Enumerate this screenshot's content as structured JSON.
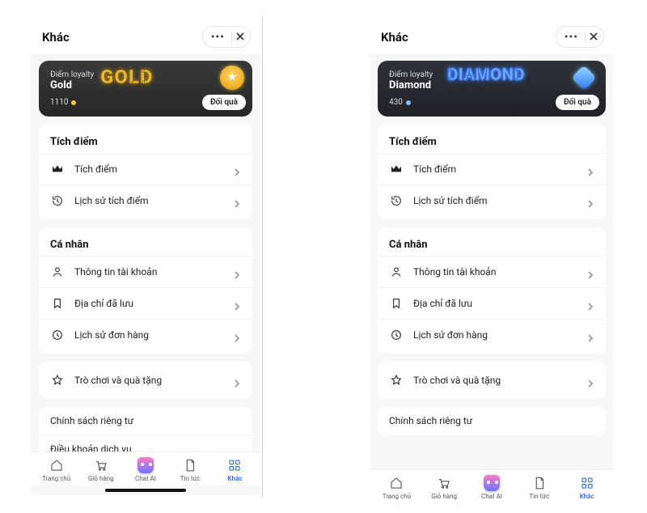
{
  "left": {
    "header": {
      "title": "Khác"
    },
    "card": {
      "sub": "Điểm loyalty",
      "tier": "Gold",
      "tier_display": "GOLD",
      "points": "1110",
      "exchange": "Đổi quà"
    },
    "points_section": {
      "title": "Tích điểm",
      "items": [
        {
          "icon": "crown",
          "label": "Tích điểm"
        },
        {
          "icon": "history",
          "label": "Lịch sử tích điểm"
        }
      ]
    },
    "personal_section": {
      "title": "Cá nhân",
      "items": [
        {
          "icon": "user",
          "label": "Thông tin tài khoản"
        },
        {
          "icon": "bookmark",
          "label": "Địa chỉ đã lưu"
        },
        {
          "icon": "clock",
          "label": "Lịch sử đơn hàng"
        }
      ]
    },
    "games_section": {
      "items": [
        {
          "icon": "star",
          "label": "Trò chơi và quà tặng"
        }
      ]
    },
    "legal_section": {
      "items": [
        {
          "label": "Chính sách riêng tư"
        },
        {
          "label": "Điều khoản dịch vụ"
        }
      ]
    },
    "footer": {
      "items": [
        {
          "icon": "home",
          "label": "Trang chủ",
          "active": false
        },
        {
          "icon": "cart",
          "label": "Giỏ hàng",
          "active": false
        },
        {
          "icon": "chatai",
          "label": "Chat AI",
          "active": false
        },
        {
          "icon": "doc",
          "label": "Tin tức",
          "active": false
        },
        {
          "icon": "grid",
          "label": "Khác",
          "active": true
        }
      ]
    }
  },
  "right": {
    "header": {
      "title": "Khác"
    },
    "card": {
      "sub": "Điểm loyalty",
      "tier": "Diamond",
      "tier_display": "DIAMOND",
      "points": "430",
      "exchange": "Đổi quà"
    },
    "points_section": {
      "title": "Tích điểm",
      "items": [
        {
          "icon": "crown",
          "label": "Tích điểm"
        },
        {
          "icon": "history",
          "label": "Lịch sử tích điểm"
        }
      ]
    },
    "personal_section": {
      "title": "Cá nhân",
      "items": [
        {
          "icon": "user",
          "label": "Thông tin tài khoản"
        },
        {
          "icon": "bookmark",
          "label": "Địa chỉ đã lưu"
        },
        {
          "icon": "clock",
          "label": "Lịch sử đơn hàng"
        }
      ]
    },
    "games_section": {
      "items": [
        {
          "icon": "star",
          "label": "Trò chơi và quà tặng"
        }
      ]
    },
    "legal_section": {
      "items": [
        {
          "label": "Chính sách riêng tư"
        }
      ]
    },
    "footer": {
      "items": [
        {
          "icon": "home",
          "label": "Trang chủ",
          "active": false
        },
        {
          "icon": "cart",
          "label": "Giỏ hàng",
          "active": false
        },
        {
          "icon": "chatai",
          "label": "Chat AI",
          "active": false
        },
        {
          "icon": "doc",
          "label": "Tin tức",
          "active": false
        },
        {
          "icon": "grid",
          "label": "Khác",
          "active": true
        }
      ]
    }
  }
}
